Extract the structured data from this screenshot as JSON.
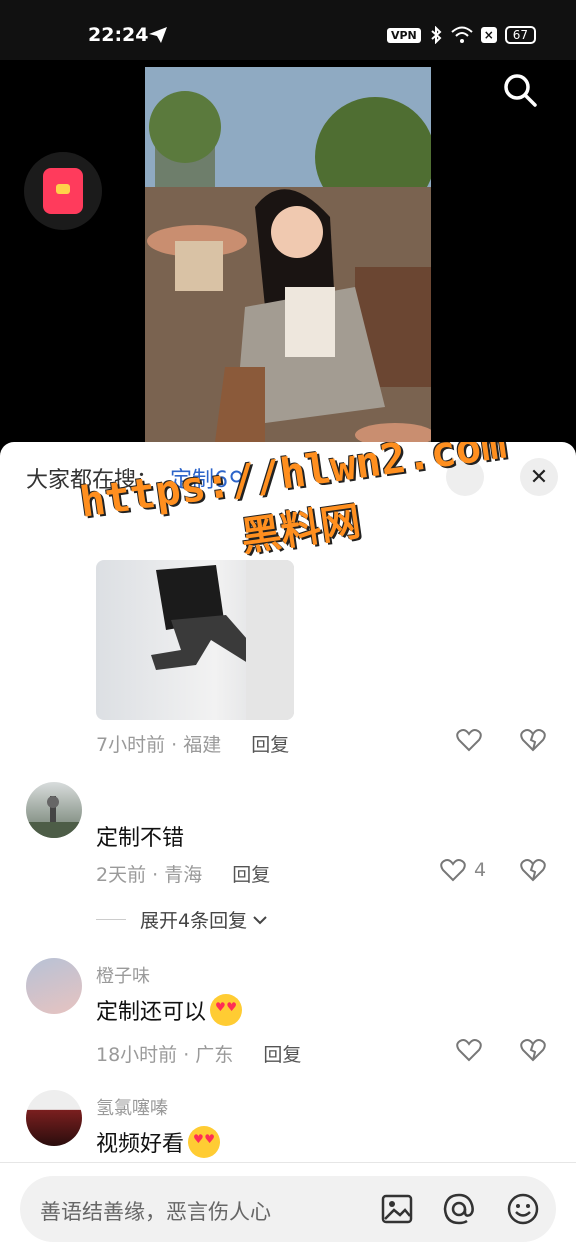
{
  "status_bar": {
    "time": "22:24",
    "vpn": "VPN",
    "battery": "67"
  },
  "sheet": {
    "hot_search_label": "大家都在搜：",
    "hot_search_term": "定制6",
    "watermark_url": "https://hlwn2.com",
    "watermark_name": "黑料网"
  },
  "comments": [
    {
      "meta": "7小时前 · 福建",
      "reply": "回复"
    },
    {
      "text": "定制不错",
      "meta": "2天前 · 青海",
      "reply": "回复",
      "likes": "4",
      "expand": "展开4条回复"
    },
    {
      "user": "橙子味",
      "text": "定制还可以",
      "meta": "18小时前 · 广东",
      "reply": "回复"
    },
    {
      "user": "氢氯噻嗪",
      "text": "视频好看"
    }
  ],
  "input": {
    "placeholder": "善语结善缘，恶言伤人心"
  },
  "icons": [
    "send-icon",
    "bluetooth-icon",
    "wifi-icon",
    "search-icon",
    "red-packet-icon",
    "close-icon",
    "heart-icon",
    "dislike-icon",
    "chevron-down-icon",
    "image-icon",
    "at-icon",
    "emoji-icon"
  ]
}
